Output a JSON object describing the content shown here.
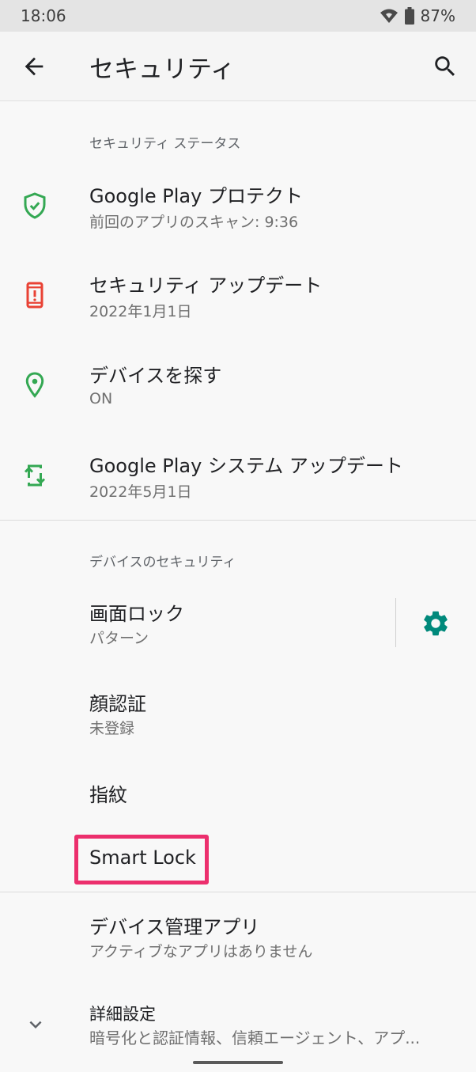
{
  "status_bar": {
    "time": "18:06",
    "battery": "87%"
  },
  "app_bar": {
    "title": "セキュリティ"
  },
  "security_status": {
    "header": "セキュリティ ステータス",
    "items": [
      {
        "title": "Google Play プロテクト",
        "subtitle": "前回のアプリのスキャン: 9:36",
        "icon": "shield-check-icon"
      },
      {
        "title": "セキュリティ アップデート",
        "subtitle": "2022年1月1日",
        "icon": "phone-alert-icon"
      },
      {
        "title": "デバイスを探す",
        "subtitle": "ON",
        "icon": "location-pin-icon"
      },
      {
        "title": "Google Play システム アップデート",
        "subtitle": "2022年5月1日",
        "icon": "phone-sync-icon"
      }
    ]
  },
  "device_security": {
    "header": "デバイスのセキュリティ",
    "items": [
      {
        "title": "画面ロック",
        "subtitle": "パターン"
      },
      {
        "title": "顔認証",
        "subtitle": "未登録"
      },
      {
        "title": "指紋"
      },
      {
        "title": "Smart Lock"
      }
    ]
  },
  "other": {
    "items": [
      {
        "title": "デバイス管理アプリ",
        "subtitle": "アクティブなアプリはありません"
      },
      {
        "title": "詳細設定",
        "subtitle": "暗号化と認証情報、信頼エージェント、アプ..."
      }
    ]
  },
  "colors": {
    "accent": "#00897b",
    "green": "#34a853",
    "red": "#e94235",
    "highlight": "#ec2f6d"
  }
}
